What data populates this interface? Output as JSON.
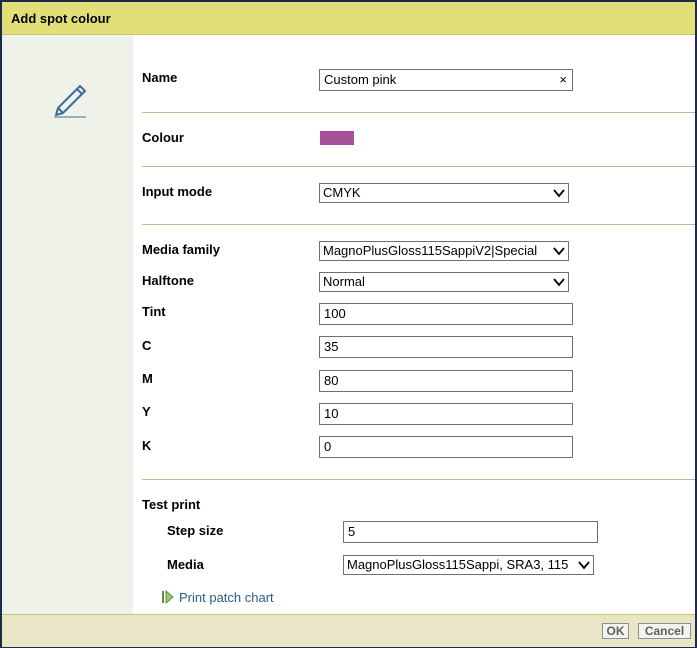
{
  "dialog": {
    "title": "Add spot colour"
  },
  "icons": {
    "edit": "pencil-icon",
    "dropdown": "chevron-down-icon",
    "clear": "clear-icon",
    "link": "play-arrow-icon"
  },
  "name": {
    "label": "Name",
    "value": "Custom pink",
    "clear_glyph": "×"
  },
  "colour": {
    "label": "Colour",
    "swatch": "#a64f9a"
  },
  "input_mode": {
    "label": "Input mode",
    "value": "CMYK"
  },
  "media_family": {
    "label": "Media family",
    "value": "MagnoPlusGloss115SappiV2|Special"
  },
  "halftone": {
    "label": "Halftone",
    "value": "Normal"
  },
  "tint": {
    "label": "Tint",
    "value": "100"
  },
  "c": {
    "label": "C",
    "value": "35"
  },
  "m": {
    "label": "M",
    "value": "80"
  },
  "y": {
    "label": "Y",
    "value": "10"
  },
  "k": {
    "label": "K",
    "value": "0"
  },
  "test_print": {
    "label": "Test print",
    "step_size": {
      "label": "Step size",
      "value": "5"
    },
    "media": {
      "label": "Media",
      "value": "MagnoPlusGloss115Sappi, SRA3, 115"
    },
    "link_label": "Print patch chart"
  },
  "buttons": {
    "ok": "OK",
    "cancel": "Cancel"
  },
  "colors": {
    "titlebar": "#e2df78",
    "leftpane": "#eff2e9",
    "separator": "#b4bf98",
    "link": "#2c5d86",
    "border": "#1c2b4a"
  }
}
